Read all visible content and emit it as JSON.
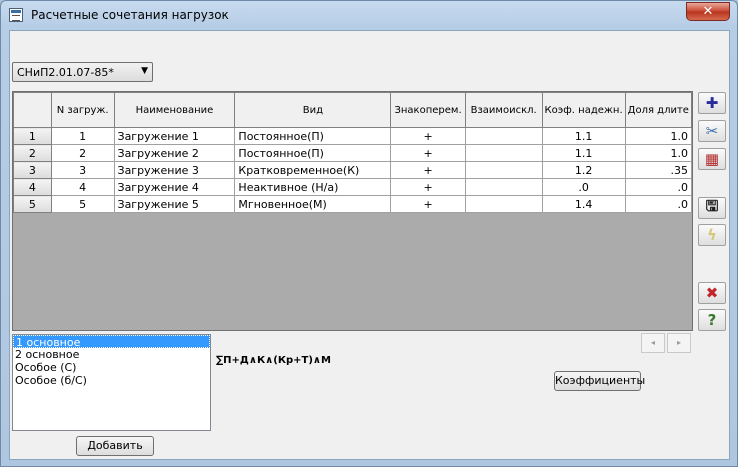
{
  "window": {
    "title": "Расчетные сочетания нагрузок",
    "close_label": "✕"
  },
  "norm_select": {
    "value": "СНиП2.01.07-85*",
    "arrow": "▼"
  },
  "table": {
    "headers": [
      "",
      "N загруж.",
      "Наименование",
      "Вид",
      "Знакоперем.",
      "Взаимоискл.",
      "Коэф. надежн.",
      "Доля длите"
    ],
    "rows": [
      [
        "1",
        "1",
        "Загружение 1",
        "Постоянное(П)",
        "+",
        "",
        "1.1",
        "1.0"
      ],
      [
        "2",
        "2",
        "Загружение 2",
        "Постоянное(П)",
        "+",
        "",
        "1.1",
        "1.0"
      ],
      [
        "3",
        "3",
        "Загружение 3",
        "Кратковременное(К)",
        "+",
        "",
        "1.2",
        ".35"
      ],
      [
        "4",
        "4",
        "Загружение 4",
        "Неактивное (Н/а)",
        "+",
        "",
        ".0",
        ".0"
      ],
      [
        "5",
        "5",
        "Загружение 5",
        "Мгновенное(М)",
        "+",
        "",
        "1.4",
        ".0"
      ]
    ]
  },
  "toolbar_icons": [
    {
      "name": "add-row-icon",
      "glyph": "✚",
      "color": "#2a2a9a",
      "enabled": true
    },
    {
      "name": "scissors-icon",
      "glyph": "✂",
      "color": "#3a6fa8",
      "enabled": true
    },
    {
      "name": "delete-table-icon",
      "glyph": "▦",
      "color": "#b0262a",
      "enabled": true
    },
    {
      "name": "save-icon",
      "glyph": "🖫",
      "color": "#222222",
      "enabled": true
    },
    {
      "name": "calc-sum-icon",
      "glyph": "ϟ",
      "color": "#d6c77a",
      "enabled": false
    },
    {
      "name": "close-red-icon",
      "glyph": "✖",
      "color": "#c0262a",
      "enabled": true
    },
    {
      "name": "help-icon",
      "glyph": "?",
      "color": "#3a7a2a",
      "enabled": true
    }
  ],
  "combinations": {
    "items": [
      "1 основное",
      "2 основное",
      "Особое (С)",
      "Особое (б/С)"
    ],
    "selected_index": 0
  },
  "formula": "∑П+Д∧К∧(Кр+Т)∧М",
  "buttons": {
    "coefficients": "Коэффициенты",
    "add": "Добавить"
  },
  "scroll": {
    "left": "◂",
    "right": "▸"
  }
}
